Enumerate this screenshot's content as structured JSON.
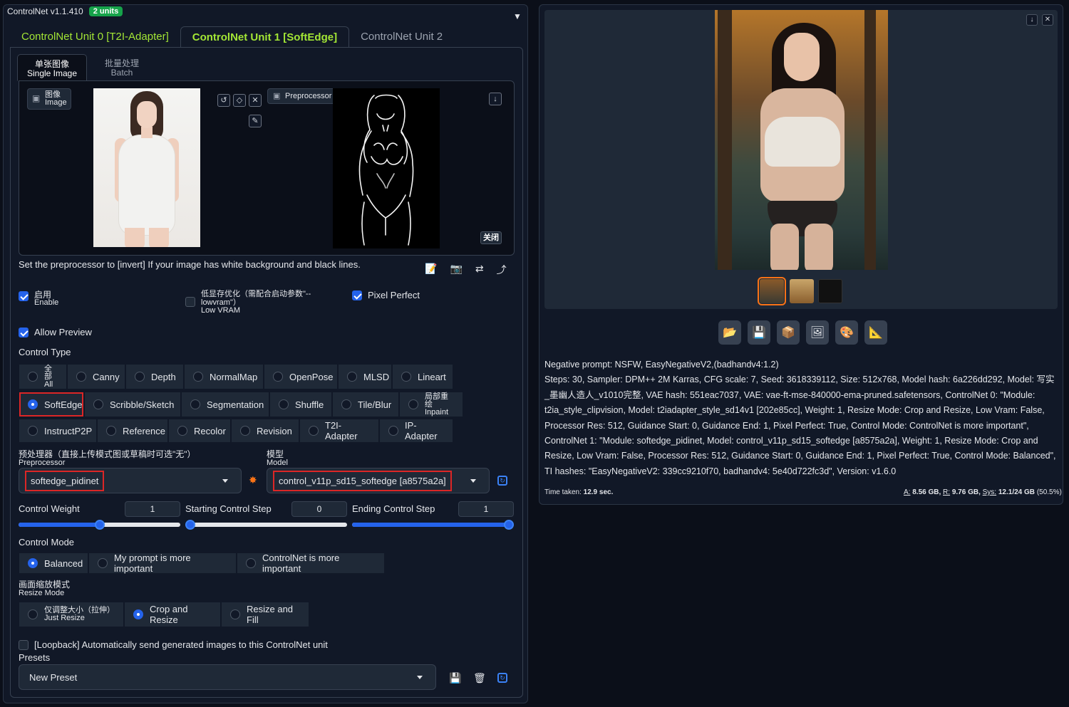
{
  "header": {
    "title": "ControlNet v1.1.410",
    "units_badge": "2 units",
    "collapse_glyph": "▼"
  },
  "unit_tabs": [
    {
      "label": "ControlNet Unit 0 [T2I-Adapter]"
    },
    {
      "label": "ControlNet Unit 1 [SoftEdge]"
    },
    {
      "label": "ControlNet Unit 2"
    }
  ],
  "image_tabs": [
    {
      "cn": "单张图像",
      "en": "Single Image"
    },
    {
      "cn": "批量处理",
      "en": "Batch"
    }
  ],
  "image_label": {
    "cn": "图像",
    "en": "Image"
  },
  "preprocessor_preview_label": "Preprocessor Preview",
  "close_label": "关闭",
  "hint_text": "Set the preprocessor to [invert] If your image has white background and black lines.",
  "checkboxes": {
    "enable": {
      "cn": "启用",
      "en": "Enable",
      "checked": true
    },
    "low_vram": {
      "cn": "低显存优化（需配合启动参数\"--",
      "cn2": "lowvram\"）",
      "en": "Low VRAM",
      "checked": false
    },
    "pixel_perfect": {
      "label": "Pixel Perfect",
      "checked": true
    },
    "allow_preview": {
      "label": "Allow Preview",
      "checked": true
    },
    "loopback": {
      "label": "[Loopback] Automatically send generated images to this ControlNet unit",
      "checked": false
    }
  },
  "control_type": {
    "label": "Control Type",
    "row1": [
      {
        "cn": "全部",
        "en": "All"
      },
      {
        "label": "Canny"
      },
      {
        "label": "Depth"
      },
      {
        "label": "NormalMap"
      },
      {
        "label": "OpenPose"
      },
      {
        "label": "MLSD"
      },
      {
        "label": "Lineart"
      }
    ],
    "row2": [
      {
        "label": "SoftEdge",
        "selected": true
      },
      {
        "label": "Scribble/Sketch"
      },
      {
        "label": "Segmentation"
      },
      {
        "label": "Shuffle"
      },
      {
        "label": "Tile/Blur"
      },
      {
        "cn": "局部重绘",
        "en": "Inpaint"
      }
    ],
    "row3": [
      {
        "label": "InstructP2P"
      },
      {
        "label": "Reference"
      },
      {
        "label": "Recolor"
      },
      {
        "label": "Revision"
      },
      {
        "label": "T2I-Adapter"
      },
      {
        "label": "IP-Adapter"
      }
    ]
  },
  "preprocessor": {
    "cn": "预处理器（直接上传模式图或草稿时可选\"无\"）",
    "en": "Preprocessor",
    "value": "softedge_pidinet"
  },
  "model": {
    "cn": "模型",
    "en": "Model",
    "value": "control_v11p_sd15_softedge [a8575a2a]"
  },
  "sliders": {
    "control_weight": {
      "label": "Control Weight",
      "value": "1",
      "min": 0,
      "max": 2,
      "current": 1
    },
    "starting_step": {
      "label": "Starting Control Step",
      "value": "0",
      "min": 0,
      "max": 1,
      "current": 0
    },
    "ending_step": {
      "label": "Ending Control Step",
      "value": "1",
      "min": 0,
      "max": 1,
      "current": 1
    }
  },
  "control_mode": {
    "label": "Control Mode",
    "options": [
      {
        "label": "Balanced",
        "selected": true
      },
      {
        "label": "My prompt is more important"
      },
      {
        "label": "ControlNet is more important"
      }
    ]
  },
  "resize_mode": {
    "cn": "画面缩放模式",
    "en": "Resize Mode",
    "options": [
      {
        "cn": "仅调整大小（拉伸）",
        "en": "Just Resize"
      },
      {
        "label": "Crop and Resize",
        "selected": true
      },
      {
        "label": "Resize and Fill"
      }
    ]
  },
  "presets": {
    "label": "Presets",
    "value": "New Preset"
  },
  "output": {
    "negative_prompt": "Negative prompt: NSFW, EasyNegativeV2,(badhandv4:1.2)",
    "params": "Steps: 30, Sampler: DPM++ 2M Karras, CFG scale: 7, Seed: 3618339112, Size: 512x768, Model hash: 6a226dd292, Model: 写实_墨幽人造人_v1010完整, VAE hash: 551eac7037, VAE: vae-ft-mse-840000-ema-pruned.safetensors, ControlNet 0: \"Module: t2ia_style_clipvision, Model: t2iadapter_style_sd14v1 [202e85cc], Weight: 1, Resize Mode: Crop and Resize, Low Vram: False, Processor Res: 512, Guidance Start: 0, Guidance End: 1, Pixel Perfect: True, Control Mode: ControlNet is more important\", ControlNet 1: \"Module: softedge_pidinet, Model: control_v11p_sd15_softedge [a8575a2a], Weight: 1, Resize Mode: Crop and Resize, Low Vram: False, Processor Res: 512, Guidance Start: 0, Guidance End: 1, Pixel Perfect: True, Control Mode: Balanced\", TI hashes: \"EasyNegativeV2: 339cc9210f70, badhandv4: 5e40d722fc3d\", Version: v1.6.0",
    "time_label": "Time taken:",
    "time_value": "12.9 sec.",
    "vram_a_label": "A:",
    "vram_a": "8.56 GB,",
    "vram_r_label": "R:",
    "vram_r": "9.76 GB,",
    "vram_sys_label": "Sys:",
    "vram_sys": "12.1/24 GB",
    "vram_pct": "(50.5%)"
  },
  "colors": {
    "accent": "#2563eb",
    "unit_tab_text": "#a3e635",
    "highlight_box": "#dc2626",
    "selected_thumb": "#f97316",
    "badge": "#16a34a"
  }
}
